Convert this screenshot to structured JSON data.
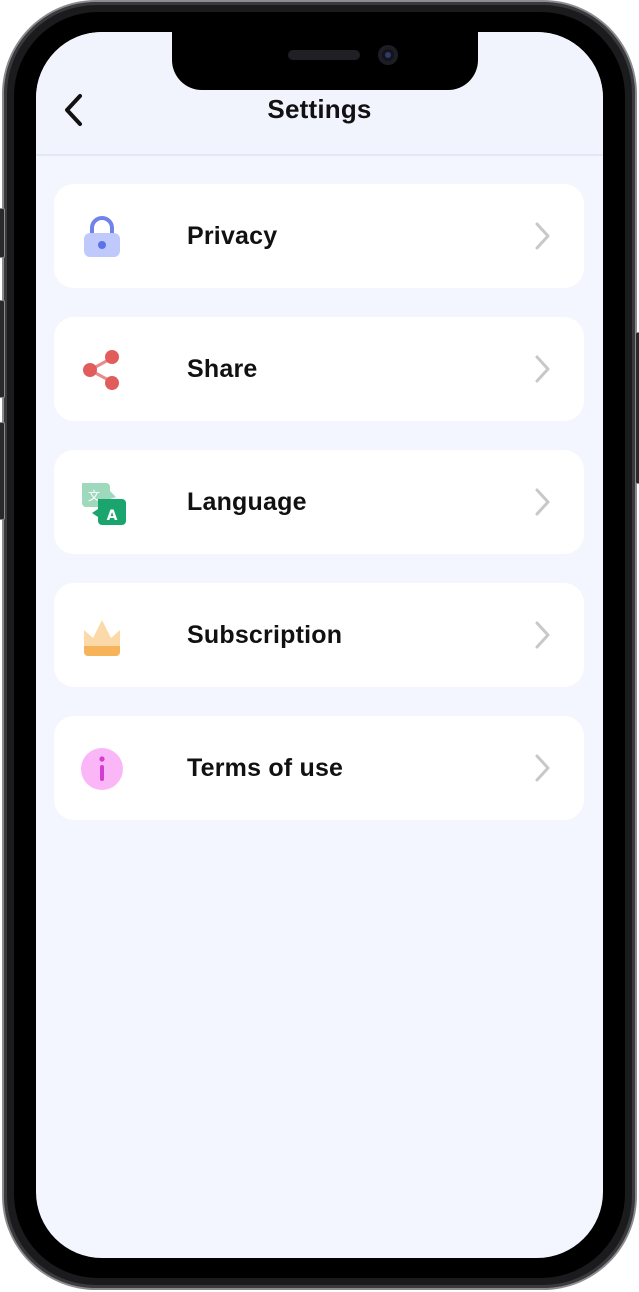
{
  "header": {
    "title": "Settings",
    "back_icon": "chevron-left-icon"
  },
  "settings": {
    "items": [
      {
        "label": "Privacy",
        "icon": "lock-icon",
        "color": "#7c8ef0"
      },
      {
        "label": "Share",
        "icon": "share-icon",
        "color": "#e25c5c"
      },
      {
        "label": "Language",
        "icon": "translate-icon",
        "color": "#1aa56e"
      },
      {
        "label": "Subscription",
        "icon": "crown-icon",
        "color": "#f7b35a"
      },
      {
        "label": "Terms of use",
        "icon": "info-icon",
        "color": "#f48af0"
      }
    ],
    "chevron_icon": "chevron-right-icon"
  },
  "colors": {
    "screen_background": "#f3f6fe",
    "card_background": "#ffffff",
    "text": "#111111",
    "chevron": "#c8c8cc"
  }
}
